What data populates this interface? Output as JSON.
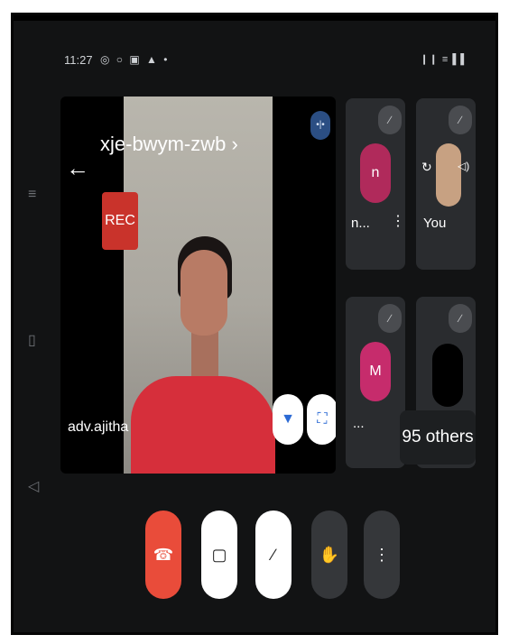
{
  "status_bar": {
    "time": "11:27",
    "left_icons": "◎ ○ ▣ ▲ •",
    "right_icons": "❙❙ ≡ ▌▌"
  },
  "meeting": {
    "code": "xje-bwym-zwb ›",
    "rec_label": "REC",
    "speaker_name": "adv.ajitha"
  },
  "participants": [
    {
      "initial": "n",
      "label": "n...",
      "avatar_color": "#b02a5b"
    },
    {
      "label": "You"
    },
    {
      "initial": "M",
      "label": "...",
      "avatar_color": "#c62c6c"
    },
    {
      "label": ""
    }
  ],
  "others_label": "95 others",
  "icons": {
    "back": "←",
    "audio": "•|•",
    "pin": "▼",
    "fullscreen": "⛶",
    "mic_off": "∕",
    "more_vert": "⋮",
    "hangup": "☎",
    "cam_off": "▢",
    "hand": "✋",
    "switch_cam": "↻",
    "speaker": "◁)"
  },
  "colors": {
    "hangup": "#e94c3a",
    "rec": "#c9332b",
    "accent_blue": "#2b6ad4"
  }
}
